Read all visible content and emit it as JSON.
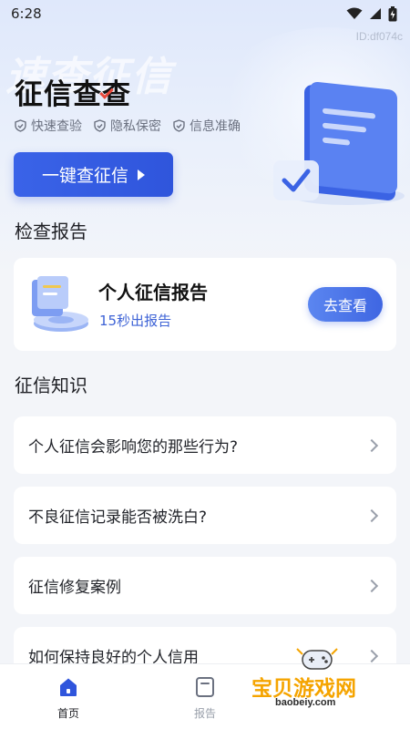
{
  "status_bar": {
    "time": "6:28"
  },
  "device_id": "ID:df074c",
  "hero": {
    "watermark": "速查征信",
    "title": "征信查查",
    "features": [
      "快速查验",
      "隐私保密",
      "信息准确"
    ],
    "cta_label": "一键查征信"
  },
  "report_section": {
    "title": "检查报告",
    "card": {
      "name": "个人征信报告",
      "subtitle": "15秒出报告",
      "button_label": "去查看"
    }
  },
  "knowledge_section": {
    "title": "征信知识",
    "items": [
      "个人征信会影响您的那些行为?",
      "不良征信记录能否被洗白?",
      "征信修复案例",
      "如何保持良好的个人信用"
    ]
  },
  "tab_bar": {
    "tabs": [
      {
        "label": "首页",
        "active": true
      },
      {
        "label": "报告",
        "active": false
      }
    ]
  },
  "overlay_watermark": {
    "text": "宝贝游戏网",
    "url": "baobeiy.com"
  },
  "colors": {
    "primary": "#3a63e8",
    "accent_text": "#3e63d6",
    "background": "#f3f5f9"
  }
}
